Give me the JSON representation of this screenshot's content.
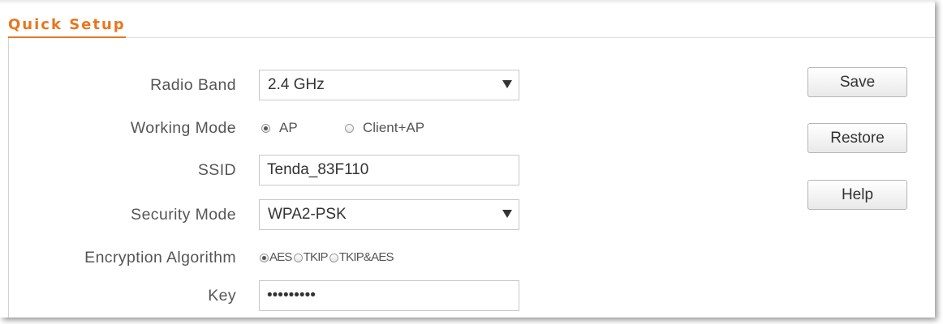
{
  "page": {
    "title": "Quick Setup"
  },
  "colors": {
    "accent": "#e8761d"
  },
  "form": {
    "radio_band": {
      "label": "Radio Band",
      "value": "2.4 GHz",
      "icon": "chevron-down-icon"
    },
    "working_mode": {
      "label": "Working Mode",
      "options": [
        {
          "label": "AP",
          "checked": true
        },
        {
          "label": "Client+AP",
          "checked": false
        }
      ]
    },
    "ssid": {
      "label": "SSID",
      "value": "Tenda_83F110"
    },
    "security_mode": {
      "label": "Security Mode",
      "value": "WPA2-PSK",
      "icon": "chevron-down-icon"
    },
    "encryption_algorithm": {
      "label": "Encryption Algorithm",
      "options": [
        {
          "label": "AES",
          "checked": true
        },
        {
          "label": "TKIP",
          "checked": false
        },
        {
          "label": "TKIP&AES",
          "checked": false
        }
      ]
    },
    "key": {
      "label": "Key",
      "value": "•••••••••"
    }
  },
  "buttons": {
    "save": "Save",
    "restore": "Restore",
    "help": "Help"
  }
}
